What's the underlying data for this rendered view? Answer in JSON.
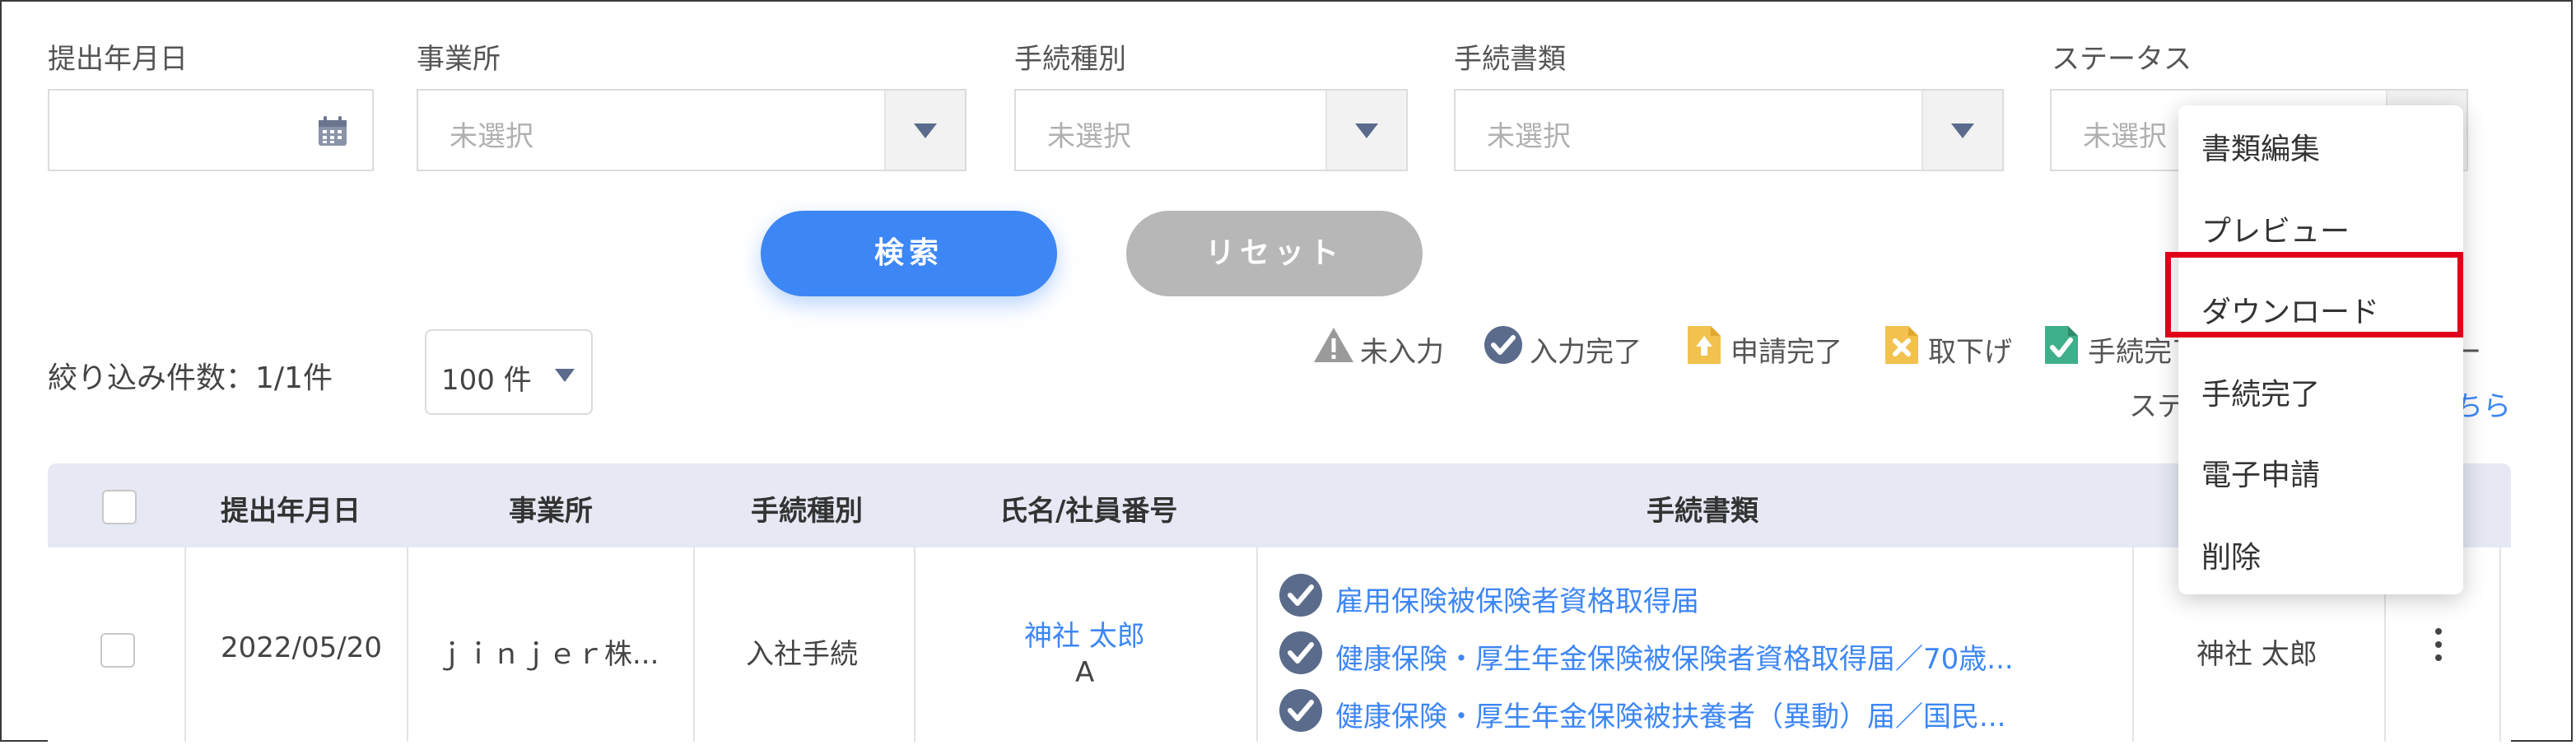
{
  "filters": {
    "submit_date_label": "提出年月日",
    "office_label": "事業所",
    "procedure_type_label": "手続種別",
    "procedure_docs_label": "手続書類",
    "status_label": "ステータス",
    "placeholder": "未選択"
  },
  "buttons": {
    "search": "検索",
    "reset": "リセット"
  },
  "results": {
    "count_text": "絞り込み件数：1/1件",
    "per_page": "100 件"
  },
  "legend": {
    "items": [
      "未入力",
      "入力完了",
      "申請完了",
      "取下げ",
      "手続完了"
    ],
    "truncated_tail": "ー",
    "status_text_fragment": "ステ",
    "link_fragment": "ちら"
  },
  "table": {
    "headers": [
      "提出年月日",
      "事業所",
      "手続種別",
      "氏名/社員番号",
      "手続書類"
    ],
    "rows": [
      {
        "date": "2022/05/20",
        "office": "ｊｉｎｊｅｒ株...",
        "procedure": "入社手続",
        "name": "神社 太郎",
        "employee_no": "A",
        "documents": [
          "雇用保険被保険者資格取得届",
          "健康保険・厚生年金保険被保険者資格取得届／70歳...",
          "健康保険・厚生年金保険被扶養者（異動）届／国民..."
        ],
        "assignee": "神社 太郎"
      }
    ]
  },
  "context_menu": {
    "items": [
      "書類編集",
      "プレビュー",
      "ダウンロード",
      "手続完了",
      "電子申請",
      "削除"
    ],
    "highlighted": "ダウンロード"
  },
  "colors": {
    "accent": "#3d86f5",
    "highlight": "#e0001a",
    "header_bg": "#e6e9f4"
  }
}
